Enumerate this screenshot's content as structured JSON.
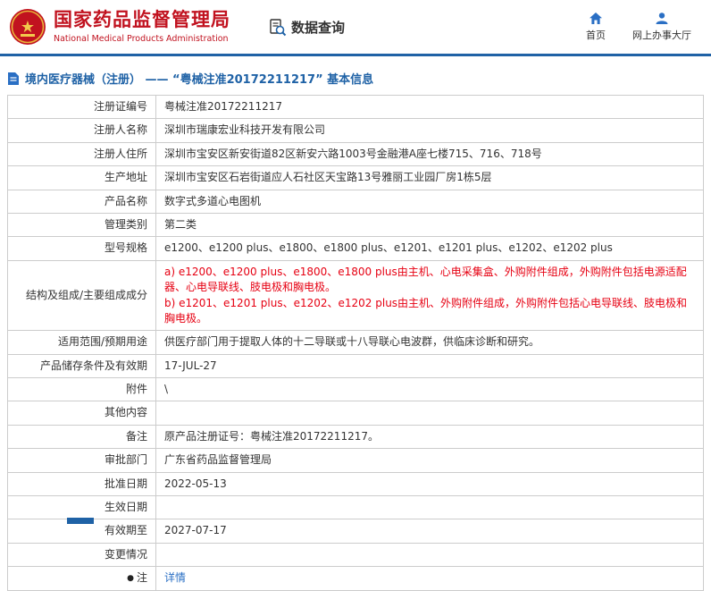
{
  "colors": {
    "brand-red": "#c1121f",
    "brand-blue": "#1f62a6",
    "link-blue": "#2a6fc4",
    "alert-red": "#e60012",
    "border-gray": "#cccccc"
  },
  "header": {
    "agency_cn": "国家药品监督管理局",
    "agency_en": "National Medical Products Administration",
    "section_label": "数据查询",
    "nav": [
      {
        "label": "首页",
        "icon": "home-icon"
      },
      {
        "label": "网上办事大厅",
        "icon": "user-icon"
      }
    ]
  },
  "breadcrumb": {
    "text": "境内医疗器械（注册） —— “粤械注准20172211217” 基本信息"
  },
  "table": {
    "rows": [
      {
        "label": "注册证编号",
        "value": "粤械注准20172211217"
      },
      {
        "label": "注册人名称",
        "value": "深圳市瑞康宏业科技开发有限公司"
      },
      {
        "label": "注册人住所",
        "value": "深圳市宝安区新安街道82区新安六路1003号金融港A座七楼715、716、718号"
      },
      {
        "label": "生产地址",
        "value": "深圳市宝安区石岩街道应人石社区天宝路13号雅丽工业园厂房1栋5层"
      },
      {
        "label": "产品名称",
        "value": "数字式多道心电图机"
      },
      {
        "label": "管理类别",
        "value": "第二类"
      },
      {
        "label": "型号规格",
        "value": "e1200、e1200 plus、e1800、e1800 plus、e1201、e1201 plus、e1202、e1202 plus"
      },
      {
        "label": "结构及组成/主要组成成分",
        "value": "a) e1200、e1200 plus、e1800、e1800 plus由主机、心电采集盒、外购附件组成，外购附件包括电源适配器、心电导联线、肢电极和胸电极。\nb) e1201、e1201 plus、e1202、e1202 plus由主机、外购附件组成，外购附件包括心电导联线、肢电极和胸电极。",
        "red": true
      },
      {
        "label": "适用范围/预期用途",
        "value": "供医疗部门用于提取人体的十二导联或十八导联心电波群，供临床诊断和研究。"
      },
      {
        "label": "产品储存条件及有效期",
        "value": "17-JUL-27"
      },
      {
        "label": "附件",
        "value": "\\"
      },
      {
        "label": "其他内容",
        "value": ""
      },
      {
        "label": "备注",
        "value": "原产品注册证号：粤械注准20172211217。"
      },
      {
        "label": "审批部门",
        "value": "广东省药品监督管理局"
      },
      {
        "label": "批准日期",
        "value": "2022-05-13"
      },
      {
        "label": "生效日期",
        "value": ""
      },
      {
        "label": "有效期至",
        "value": "2027-07-17"
      },
      {
        "label": "变更情况",
        "value": ""
      },
      {
        "label": "注",
        "label_icon_char": "●",
        "value": "详情",
        "link": true
      }
    ]
  }
}
